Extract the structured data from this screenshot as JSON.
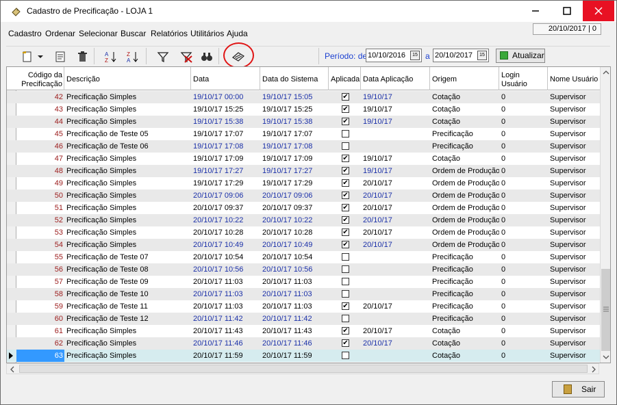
{
  "window": {
    "title": "Cadastro de Precificação - LOJA 1",
    "date_display": "20/10/2017 | 0"
  },
  "menu": [
    "Cadastro",
    "Ordenar",
    "Selecionar",
    "Buscar",
    "Relatórios",
    "Utilitários",
    "Ajuda"
  ],
  "toolbar": {
    "icons": [
      "new-icon",
      "dropdown-arrow-icon",
      "edit-icon",
      "delete-icon",
      "sort-asc-icon",
      "sort-desc-icon",
      "filter-icon",
      "clear-filter-icon",
      "find-icon",
      "apply-pricing-icon"
    ],
    "periodo_label": "Período: de",
    "date_from": "10/10/2016",
    "a_label": "a",
    "date_to": "20/10/2017",
    "atualizar_label": "Atualizar",
    "highlight_color": "#e01414"
  },
  "grid": {
    "columns": [
      "Código da Precificação",
      "Descrição",
      "Data",
      "Data do Sistema",
      "Aplicada",
      "Data Aplicação",
      "Origem",
      "Login Usuário",
      "Nome Usuário"
    ],
    "rows": [
      {
        "code": "42",
        "desc": "Precificação Simples",
        "data": "19/10/17  00:00",
        "sistema": "19/10/17  15:05",
        "aplicada": true,
        "data_aplic": "19/10/17",
        "origem": "Cotação",
        "login": "0",
        "nome": "Supervisor",
        "blue": true
      },
      {
        "code": "43",
        "desc": "Precificação Simples",
        "data": "19/10/17  15:25",
        "sistema": "19/10/17  15:25",
        "aplicada": true,
        "data_aplic": "19/10/17",
        "origem": "Cotação",
        "login": "0",
        "nome": "Supervisor",
        "blue": false
      },
      {
        "code": "44",
        "desc": "Precificação Simples",
        "data": "19/10/17  15:38",
        "sistema": "19/10/17  15:38",
        "aplicada": true,
        "data_aplic": "19/10/17",
        "origem": "Cotação",
        "login": "0",
        "nome": "Supervisor",
        "blue": true
      },
      {
        "code": "45",
        "desc": "Precificação de Teste 05",
        "data": "19/10/17  17:07",
        "sistema": "19/10/17  17:07",
        "aplicada": false,
        "data_aplic": "",
        "origem": "Precificação",
        "login": "0",
        "nome": "Supervisor",
        "blue": false
      },
      {
        "code": "46",
        "desc": "Precificação de Teste 06",
        "data": "19/10/17  17:08",
        "sistema": "19/10/17  17:08",
        "aplicada": false,
        "data_aplic": "",
        "origem": "Precificação",
        "login": "0",
        "nome": "Supervisor",
        "blue": true
      },
      {
        "code": "47",
        "desc": "Precificação Simples",
        "data": "19/10/17  17:09",
        "sistema": "19/10/17  17:09",
        "aplicada": true,
        "data_aplic": "19/10/17",
        "origem": "Cotação",
        "login": "0",
        "nome": "Supervisor",
        "blue": false
      },
      {
        "code": "48",
        "desc": "Precificação Simples",
        "data": "19/10/17  17:27",
        "sistema": "19/10/17  17:27",
        "aplicada": true,
        "data_aplic": "19/10/17",
        "origem": "Ordem de Produção",
        "login": "0",
        "nome": "Supervisor",
        "blue": true
      },
      {
        "code": "49",
        "desc": "Precificação Simples",
        "data": "19/10/17  17:29",
        "sistema": "19/10/17  17:29",
        "aplicada": true,
        "data_aplic": "20/10/17",
        "origem": "Ordem de Produção",
        "login": "0",
        "nome": "Supervisor",
        "blue": false
      },
      {
        "code": "50",
        "desc": "Precificação Simples",
        "data": "20/10/17  09:06",
        "sistema": "20/10/17  09:06",
        "aplicada": true,
        "data_aplic": "20/10/17",
        "origem": "Ordem de Produção",
        "login": "0",
        "nome": "Supervisor",
        "blue": true
      },
      {
        "code": "51",
        "desc": "Precificação Simples",
        "data": "20/10/17  09:37",
        "sistema": "20/10/17  09:37",
        "aplicada": true,
        "data_aplic": "20/10/17",
        "origem": "Ordem de Produção",
        "login": "0",
        "nome": "Supervisor",
        "blue": false
      },
      {
        "code": "52",
        "desc": "Precificação Simples",
        "data": "20/10/17  10:22",
        "sistema": "20/10/17  10:22",
        "aplicada": true,
        "data_aplic": "20/10/17",
        "origem": "Ordem de Produção",
        "login": "0",
        "nome": "Supervisor",
        "blue": true
      },
      {
        "code": "53",
        "desc": "Precificação Simples",
        "data": "20/10/17  10:28",
        "sistema": "20/10/17  10:28",
        "aplicada": true,
        "data_aplic": "20/10/17",
        "origem": "Ordem de Produção",
        "login": "0",
        "nome": "Supervisor",
        "blue": false
      },
      {
        "code": "54",
        "desc": "Precificação Simples",
        "data": "20/10/17  10:49",
        "sistema": "20/10/17  10:49",
        "aplicada": true,
        "data_aplic": "20/10/17",
        "origem": "Ordem de Produção",
        "login": "0",
        "nome": "Supervisor",
        "blue": true
      },
      {
        "code": "55",
        "desc": "Precificação de Teste 07",
        "data": "20/10/17  10:54",
        "sistema": "20/10/17  10:54",
        "aplicada": false,
        "data_aplic": "",
        "origem": "Precificação",
        "login": "0",
        "nome": "Supervisor",
        "blue": false
      },
      {
        "code": "56",
        "desc": "Precificação de Teste 08",
        "data": "20/10/17  10:56",
        "sistema": "20/10/17  10:56",
        "aplicada": false,
        "data_aplic": "",
        "origem": "Precificação",
        "login": "0",
        "nome": "Supervisor",
        "blue": true
      },
      {
        "code": "57",
        "desc": "Precificação de Teste 09",
        "data": "20/10/17  11:03",
        "sistema": "20/10/17  11:03",
        "aplicada": false,
        "data_aplic": "",
        "origem": "Precificação",
        "login": "0",
        "nome": "Supervisor",
        "blue": false
      },
      {
        "code": "58",
        "desc": "Precificação de Teste 10",
        "data": "20/10/17  11:03",
        "sistema": "20/10/17  11:03",
        "aplicada": false,
        "data_aplic": "",
        "origem": "Precificação",
        "login": "0",
        "nome": "Supervisor",
        "blue": true
      },
      {
        "code": "59",
        "desc": "Precificação de Teste 11",
        "data": "20/10/17  11:03",
        "sistema": "20/10/17  11:03",
        "aplicada": true,
        "data_aplic": "20/10/17",
        "origem": "Precificação",
        "login": "0",
        "nome": "Supervisor",
        "blue": false
      },
      {
        "code": "60",
        "desc": "Precificação de Teste 12",
        "data": "20/10/17  11:42",
        "sistema": "20/10/17  11:42",
        "aplicada": false,
        "data_aplic": "",
        "origem": "Precificação",
        "login": "0",
        "nome": "Supervisor",
        "blue": true
      },
      {
        "code": "61",
        "desc": "Precificação Simples",
        "data": "20/10/17  11:43",
        "sistema": "20/10/17  11:43",
        "aplicada": true,
        "data_aplic": "20/10/17",
        "origem": "Cotação",
        "login": "0",
        "nome": "Supervisor",
        "blue": false
      },
      {
        "code": "62",
        "desc": "Precificação Simples",
        "data": "20/10/17  11:46",
        "sistema": "20/10/17  11:46",
        "aplicada": true,
        "data_aplic": "20/10/17",
        "origem": "Cotação",
        "login": "0",
        "nome": "Supervisor",
        "blue": true
      },
      {
        "code": "63",
        "desc": "Precificação Simples",
        "data": "20/10/17  11:59",
        "sistema": "20/10/17  11:59",
        "aplicada": false,
        "data_aplic": "",
        "origem": "Cotação",
        "login": "0",
        "nome": "Supervisor",
        "blue": false,
        "current": true
      }
    ]
  },
  "footer": {
    "sair_label": "Sair"
  }
}
